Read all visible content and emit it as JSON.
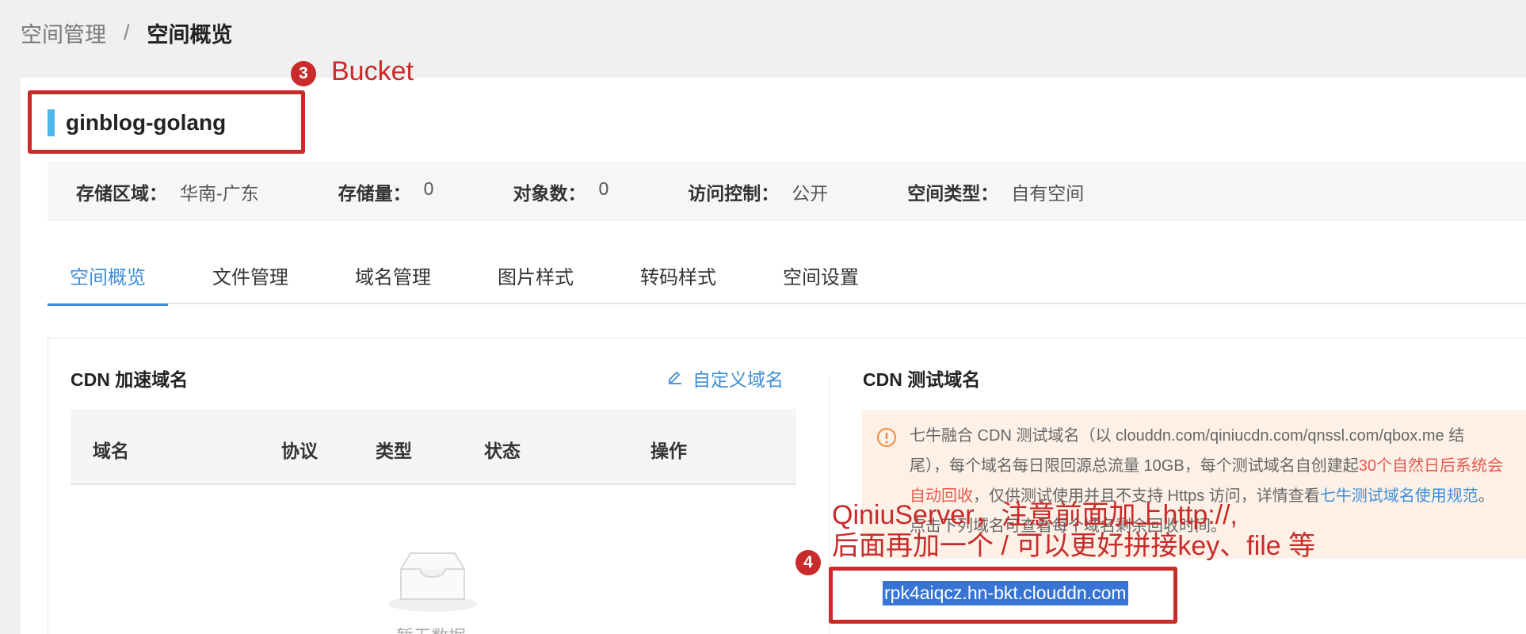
{
  "breadcrumb": {
    "parent": "空间管理",
    "separator": "/",
    "current": "空间概览"
  },
  "bucket": {
    "name": "ginblog-golang"
  },
  "info": [
    {
      "key": "存储区域：",
      "value": "华南-广东"
    },
    {
      "key": "存储量：",
      "value": "0"
    },
    {
      "key": "对象数：",
      "value": "0"
    },
    {
      "key": "访问控制：",
      "value": "公开"
    },
    {
      "key": "空间类型：",
      "value": "自有空间"
    }
  ],
  "tabs": [
    {
      "label": "空间概览",
      "active": true
    },
    {
      "label": "文件管理",
      "active": false
    },
    {
      "label": "域名管理",
      "active": false
    },
    {
      "label": "图片样式",
      "active": false
    },
    {
      "label": "转码样式",
      "active": false
    },
    {
      "label": "空间设置",
      "active": false
    }
  ],
  "cdn_accel": {
    "title": "CDN 加速域名",
    "custom_domain_label": "自定义域名",
    "columns": [
      "域名",
      "协议",
      "类型",
      "状态",
      "操作"
    ],
    "empty_text": "暂无数据"
  },
  "cdn_test": {
    "title": "CDN 测试域名",
    "notice": {
      "line1": "七牛融合 CDN 测试域名（以 clouddn.com/qiniucdn.com/qnssl.com/qbox.me 结",
      "line2_prefix": "尾），每个域名每日限回源总流量 10GB，每个测试域名自创建起",
      "line2_red": "30个自然日后系统会",
      "line3_red": "自动回收",
      "line3_mid": "，仅供测试使用并且不支持 Https 访问，详情查看",
      "line3_link": "七牛测试域名使用规范",
      "line3_end": "。",
      "line4": "点击下列域名可查看每个域名剩余回收时间。"
    },
    "domain": "rpk4aiqcz.hn-bkt.clouddn.com"
  },
  "annotations": {
    "n3": "3",
    "label3": "Bucket",
    "n4": "4",
    "label4_line1": "QiniuServer，注意前面加上http://,",
    "label4_line2": "后面再加一个 / 可以更好拼接key、file 等"
  },
  "colors": {
    "accent": "#3d8ed8",
    "annotation": "#c92a2a",
    "bucket_bar": "#4db6e8",
    "warning_bg": "#fdf1e7"
  }
}
